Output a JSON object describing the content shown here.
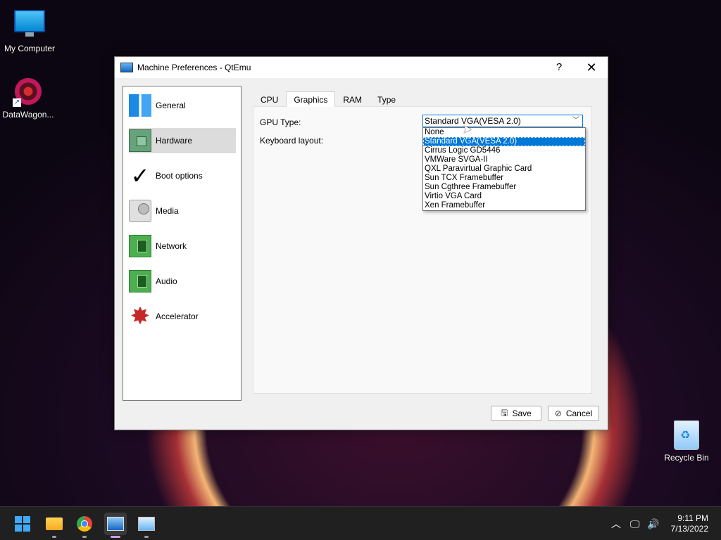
{
  "desktop": {
    "icons": [
      {
        "label": "My Computer"
      },
      {
        "label": "DataWagon..."
      },
      {
        "label": "Recycle Bin"
      }
    ]
  },
  "window": {
    "title": "Machine Preferences - QtEmu",
    "help_label": "?",
    "close_label": "✕"
  },
  "sidebar": {
    "items": [
      {
        "label": "General",
        "icon": "general-icon"
      },
      {
        "label": "Hardware",
        "icon": "hardware-chip-icon",
        "selected": true
      },
      {
        "label": "Boot options",
        "icon": "checkmark-icon"
      },
      {
        "label": "Media",
        "icon": "media-drive-icon"
      },
      {
        "label": "Network",
        "icon": "network-card-icon"
      },
      {
        "label": "Audio",
        "icon": "audio-card-icon"
      },
      {
        "label": "Accelerator",
        "icon": "accelerator-star-icon"
      }
    ]
  },
  "tabs": [
    {
      "label": "CPU"
    },
    {
      "label": "Graphics",
      "active": true
    },
    {
      "label": "RAM"
    },
    {
      "label": "Type"
    }
  ],
  "graphics": {
    "gpu_type_label": "GPU Type:",
    "keyboard_layout_label": "Keyboard layout:",
    "gpu_selected": "Standard VGA(VESA 2.0)",
    "gpu_options": [
      "None",
      "Standard VGA(VESA 2.0)",
      "Cirrus Logic GD5446",
      "VMWare SVGA-II",
      "QXL Paravirtual Graphic Card",
      "Sun TCX Framebuffer",
      "Sun Cgthree Framebuffer",
      "Virtio VGA Card",
      "Xen Framebuffer"
    ],
    "highlighted_index": 1
  },
  "buttons": {
    "save_label": "Save",
    "cancel_label": "Cancel"
  },
  "taskbar": {
    "apps": [
      "start-icon",
      "file-explorer-icon",
      "chrome-icon",
      "qtemu-icon",
      "resource-monitor-icon"
    ],
    "active_app": "qtemu-icon",
    "time": "9:11 PM",
    "date": "7/13/2022"
  },
  "colors": {
    "accent": "#0078d7",
    "selection_bg": "#dcdcdc",
    "taskbar_bg": "#202020"
  }
}
